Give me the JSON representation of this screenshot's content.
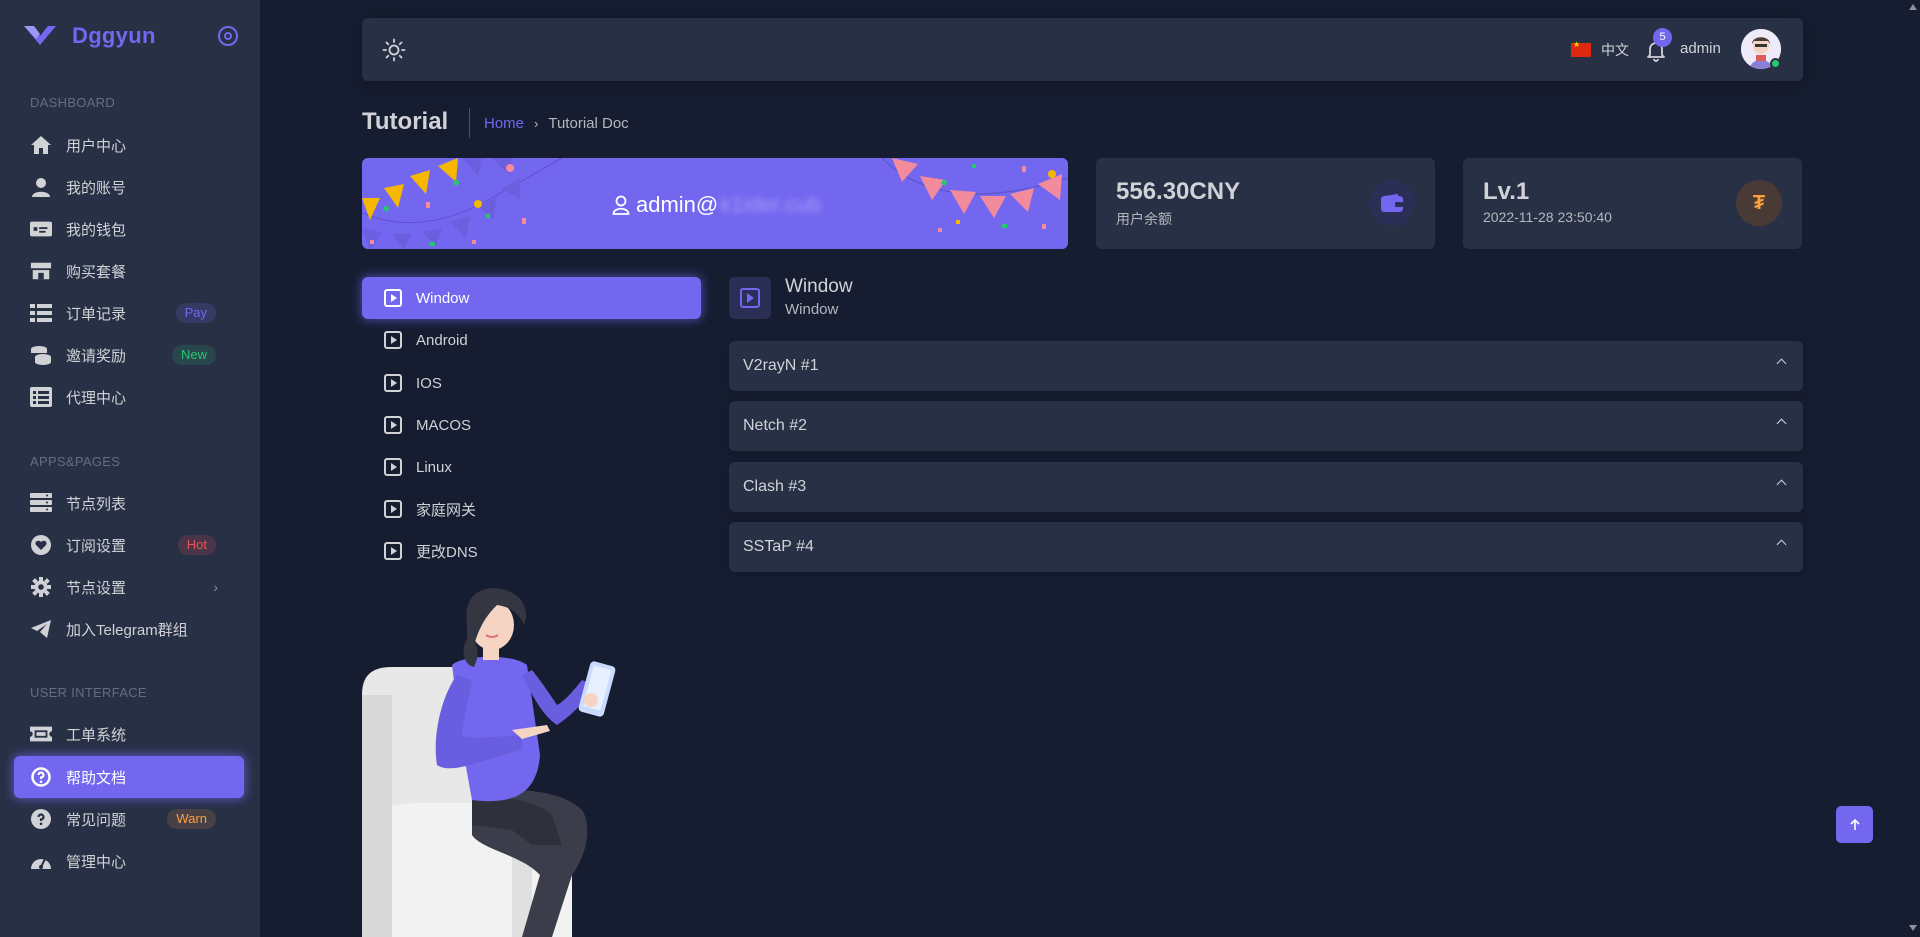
{
  "brand": {
    "name": "Dggyun"
  },
  "sidebar": {
    "sections": [
      {
        "header": "DASHBOARD"
      },
      {
        "header": "APPS&PAGES"
      },
      {
        "header": "USER INTERFACE"
      }
    ],
    "items": [
      {
        "label": "用户中心",
        "icon": "home-icon"
      },
      {
        "label": "我的账号",
        "icon": "user-icon"
      },
      {
        "label": "我的钱包",
        "icon": "wallet-icon"
      },
      {
        "label": "购买套餐",
        "icon": "store-icon"
      },
      {
        "label": "订单记录",
        "icon": "list-icon",
        "badge": "Pay"
      },
      {
        "label": "邀请奖励",
        "icon": "coins-icon",
        "badge": "New"
      },
      {
        "label": "代理中心",
        "icon": "list-alt-icon"
      },
      {
        "label": "节点列表",
        "icon": "server-icon"
      },
      {
        "label": "订阅设置",
        "icon": "heart-icon",
        "badge": "Hot"
      },
      {
        "label": "节点设置",
        "icon": "gear-icon"
      },
      {
        "label": "加入Telegram群组",
        "icon": "telegram-icon"
      },
      {
        "label": "工单系统",
        "icon": "ticket-icon"
      },
      {
        "label": "帮助文档",
        "icon": "question-icon",
        "active": true
      },
      {
        "label": "常见问题",
        "icon": "question-icon",
        "badge": "Warn"
      },
      {
        "label": "管理中心",
        "icon": "dashboard-icon"
      }
    ]
  },
  "navbar": {
    "language": "中文",
    "notifications": "5",
    "user": "admin"
  },
  "page": {
    "title": "Tutorial",
    "breadcrumb_home": "Home",
    "breadcrumb_current": "Tutorial Doc"
  },
  "welcome": {
    "user_prefix": "admin@",
    "user_masked": "k1ider.cub"
  },
  "stats": {
    "balance": {
      "value": "556.30CNY",
      "label": "用户余额"
    },
    "level": {
      "value": "Lv.1",
      "label": "2022-11-28 23:50:40"
    }
  },
  "tutorial_nav": [
    {
      "label": "Window",
      "active": true
    },
    {
      "label": "Android"
    },
    {
      "label": "IOS"
    },
    {
      "label": "MACOS"
    },
    {
      "label": "Linux"
    },
    {
      "label": "家庭网关"
    },
    {
      "label": "更改DNS"
    }
  ],
  "content": {
    "title": "Window",
    "subtitle": "Window",
    "accordion": [
      {
        "label": "V2rayN #1"
      },
      {
        "label": "Netch #2"
      },
      {
        "label": "Clash #3"
      },
      {
        "label": "SSTaP #4"
      }
    ]
  },
  "colors": {
    "primary": "#7367f0",
    "background": "#161d31",
    "card": "#283046",
    "success": "#28c76f",
    "danger": "#ea5455",
    "warning": "#ff9f43"
  }
}
